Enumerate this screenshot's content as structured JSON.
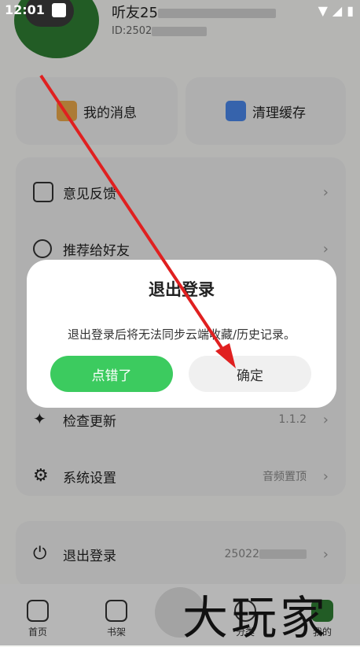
{
  "status_bar": {
    "time": "12:01",
    "icons": [
      "wifi-icon",
      "signal-icon",
      "battery-icon"
    ]
  },
  "profile": {
    "username": "听友25",
    "uid_prefix": "ID:2502"
  },
  "tiles": [
    {
      "label": "我的消息",
      "icon": "message-icon"
    },
    {
      "label": "清理缓存",
      "icon": "broom-icon"
    }
  ],
  "menu": {
    "feedback": {
      "label": "意见反馈"
    },
    "share": {
      "label": "推荐给好友"
    },
    "update": {
      "label": "检查更新",
      "value": "1.1.2"
    },
    "settings": {
      "label": "系统设置",
      "value": "音频置顶"
    },
    "logout": {
      "label": "退出登录",
      "value": "25022"
    }
  },
  "tabbar": [
    {
      "label": "首页",
      "icon": "home-icon"
    },
    {
      "label": "书架",
      "icon": "bookshelf-icon"
    },
    {
      "label": "分类",
      "icon": "category-icon"
    },
    {
      "label": "我的",
      "icon": "profile-icon"
    }
  ],
  "dialog": {
    "title": "退出登录",
    "message": "退出登录后将无法同步云端收藏/历史记录。",
    "cancel_label": "点错了",
    "confirm_label": "确定"
  },
  "watermark": "大玩家",
  "colors": {
    "accent": "#3ccb5f",
    "arrow": "#e02020"
  }
}
